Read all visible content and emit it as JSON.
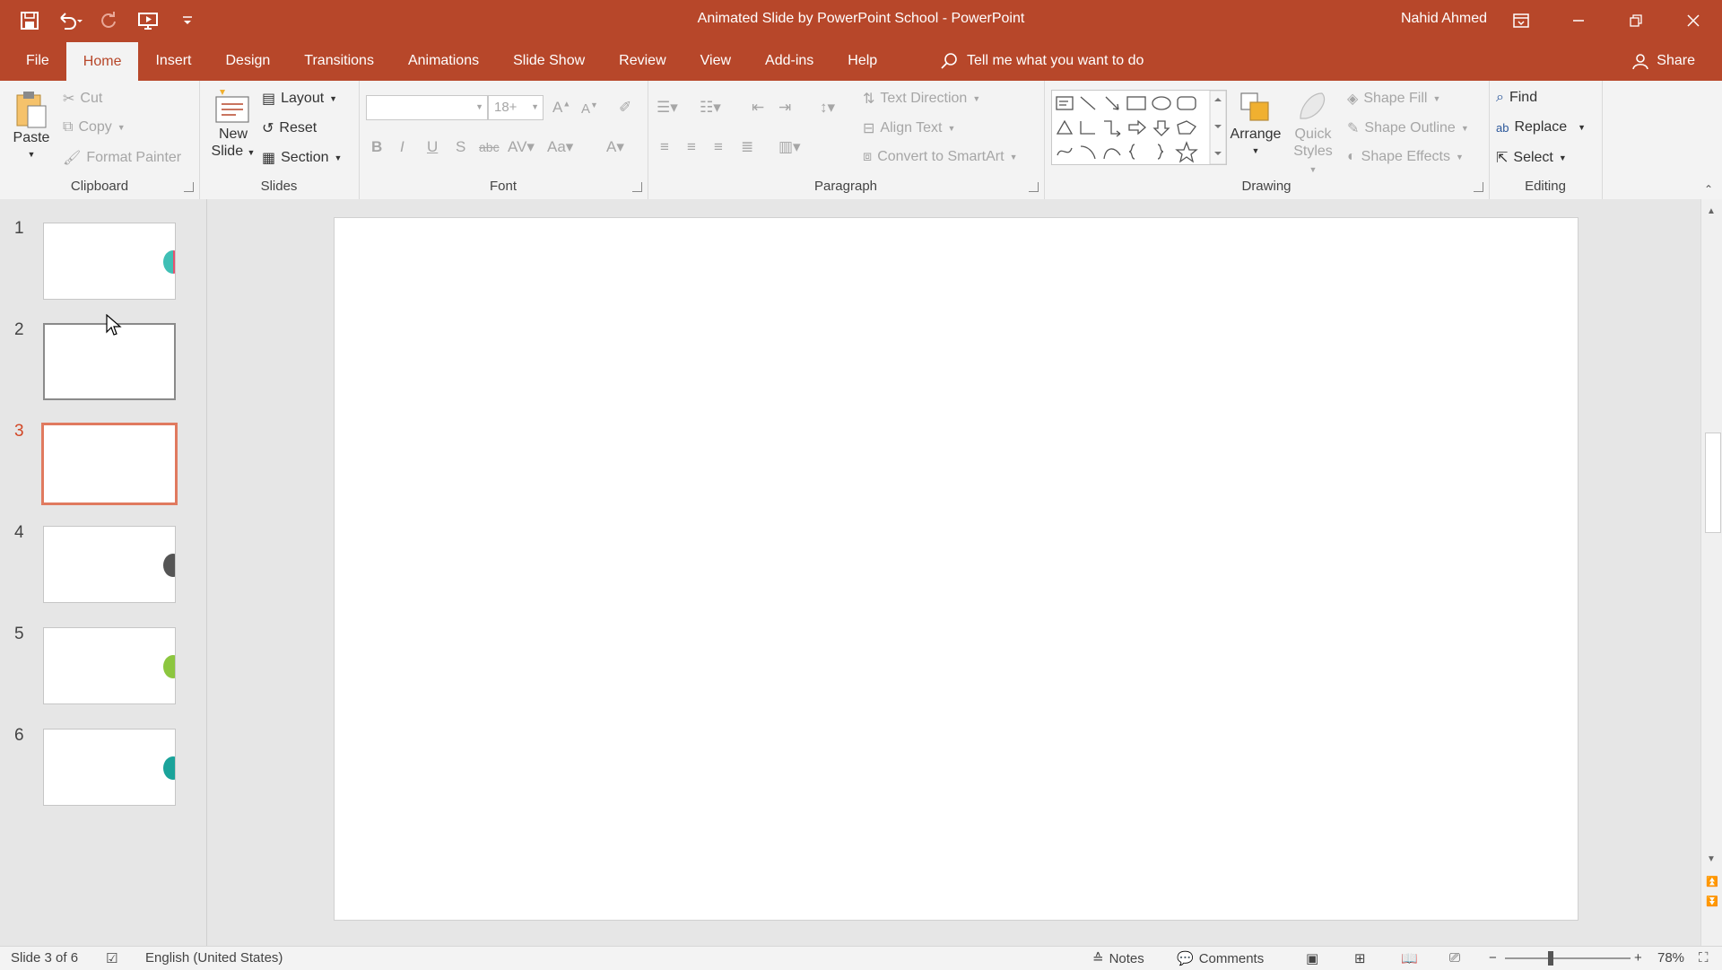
{
  "window": {
    "title": "Animated Slide by PowerPoint School  -  PowerPoint",
    "user": "Nahid Ahmed"
  },
  "tabs": [
    "File",
    "Home",
    "Insert",
    "Design",
    "Transitions",
    "Animations",
    "Slide Show",
    "Review",
    "View",
    "Add-ins",
    "Help"
  ],
  "active_tab": "Home",
  "tell_me": "Tell me what you want to do",
  "share": "Share",
  "clipboard": {
    "label": "Clipboard",
    "paste": "Paste",
    "cut": "Cut",
    "copy": "Copy",
    "format_painter": "Format Painter"
  },
  "slides_group": {
    "label": "Slides",
    "new_slide_line1": "New",
    "new_slide_line2": "Slide",
    "layout": "Layout",
    "reset": "Reset",
    "section": "Section"
  },
  "font": {
    "label": "Font",
    "name": "",
    "size": "18+"
  },
  "paragraph": {
    "label": "Paragraph",
    "text_direction": "Text Direction",
    "align_text": "Align Text",
    "convert_smartart": "Convert to SmartArt"
  },
  "drawing": {
    "label": "Drawing",
    "arrange": "Arrange",
    "quick_styles_line1": "Quick",
    "quick_styles_line2": "Styles",
    "shape_fill": "Shape Fill",
    "shape_outline": "Shape Outline",
    "shape_effects": "Shape Effects"
  },
  "editing": {
    "label": "Editing",
    "find": "Find",
    "replace": "Replace",
    "select": "Select"
  },
  "thumbnails": [
    {
      "num": "1",
      "accent": "#3fbfb5",
      "accent2": "#e8506e"
    },
    {
      "num": "2",
      "accent": ""
    },
    {
      "num": "3",
      "accent": ""
    },
    {
      "num": "4",
      "accent": "#555555"
    },
    {
      "num": "5",
      "accent": "#8cc63f"
    },
    {
      "num": "6",
      "accent": "#1aa39a"
    }
  ],
  "current_slide": 3,
  "status": {
    "slide_info": "Slide 3 of 6",
    "language": "English (United States)",
    "notes": "Notes",
    "comments": "Comments",
    "zoom": "78%"
  },
  "colors": {
    "accent": "#b7472a",
    "selected": "#d24726"
  }
}
